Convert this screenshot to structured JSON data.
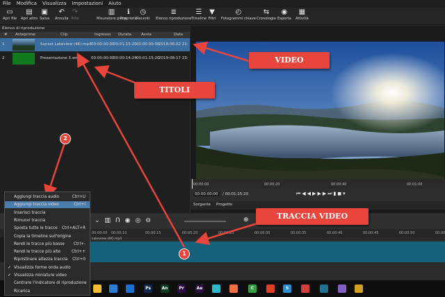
{
  "menubar": [
    "File",
    "Modifica",
    "Visualizza",
    "Impostazioni",
    "Aiuto"
  ],
  "toolbar": [
    {
      "label": "Apri file",
      "icon": "folder-icon",
      "enabled": true
    },
    {
      "label": "Apri altro",
      "icon": "open-other-icon",
      "enabled": true
    },
    {
      "label": "Salva",
      "icon": "save-icon",
      "enabled": true
    },
    {
      "label": "Annulla",
      "icon": "undo-icon",
      "enabled": true
    },
    {
      "label": "Rifai",
      "icon": "redo-icon",
      "enabled": false
    },
    {
      "label": "Misuratore picco",
      "icon": "peak-meter-icon",
      "enabled": true
    },
    {
      "label": "Proprietà",
      "icon": "info-icon",
      "enabled": true
    },
    {
      "label": "Recenti",
      "icon": "clock-icon",
      "enabled": true
    },
    {
      "label": "Elenco riproduzione",
      "icon": "playlist-icon",
      "enabled": true
    },
    {
      "label": "Timeline",
      "icon": "timeline-icon",
      "enabled": true
    },
    {
      "label": "Filtri",
      "icon": "filter-icon",
      "enabled": true
    },
    {
      "label": "Fotogrammi chiave",
      "icon": "stopwatch-icon",
      "enabled": true
    },
    {
      "label": "Cronologia",
      "icon": "history-icon",
      "enabled": true
    },
    {
      "label": "Esporta",
      "icon": "export-icon",
      "enabled": true
    },
    {
      "label": "Attività",
      "icon": "jobs-icon",
      "enabled": true
    }
  ],
  "playlist": {
    "title": "Elenco di riproduzione",
    "columns": [
      "#",
      "Anteprime",
      "Clip",
      "Ingresso",
      "Durata",
      "Avvia",
      "Data"
    ],
    "rows": [
      {
        "num": "1",
        "clip": "Sunset Lakeview (4K).mp4",
        "in": "00:00:00:00",
        "dur": "00:01:15:20",
        "start": "00:00:00:00",
        "date": "2018-06-02 21:"
      },
      {
        "num": "2",
        "clip": "Presentazione 3.wmv",
        "in": "00:00:00:00",
        "dur": "00:00:14:24",
        "start": "00:01:15:20",
        "date": "2019-08-17 23:"
      }
    ]
  },
  "player": {
    "ruler": [
      "00:00:00",
      "00:00:20",
      "00:00:40",
      "00:01:00"
    ],
    "position": "00:00:00:00",
    "duration": "/ 00:01:15:20",
    "tabs": [
      "Sorgente",
      "Progetto"
    ]
  },
  "timeline": {
    "ruler": [
      "00:00:00",
      "00:00:10",
      "00:00:15",
      "00:00:20",
      "00:00:25",
      "00:00:30",
      "00:00:35",
      "00:00:40",
      "00:00:45",
      "00:00:50",
      "00:00:5"
    ],
    "clip_label": "Lakeview (4K).mp4"
  },
  "context_menu": [
    {
      "label": "Aggiungi traccia audio",
      "shortcut": "Ctrl+U",
      "checked": false,
      "highlighted": false
    },
    {
      "label": "Aggiungi traccia video",
      "shortcut": "Ctrl+I",
      "checked": false,
      "highlighted": true
    },
    {
      "label": "Inserisci traccia",
      "shortcut": "",
      "checked": false,
      "highlighted": false
    },
    {
      "label": "Rimuovi traccia",
      "shortcut": "",
      "checked": false,
      "highlighted": false
    },
    {
      "label": "Sposta tutte le tracce",
      "shortcut": "Ctrl+ALT+R",
      "checked": false,
      "highlighted": false
    },
    {
      "label": "Copia la timeline sull'origine",
      "shortcut": "",
      "checked": false,
      "highlighted": false
    },
    {
      "label": "Rendi le tracce più basse",
      "shortcut": "Ctrl+-",
      "checked": false,
      "highlighted": false
    },
    {
      "label": "Rendi le tracce più alte",
      "shortcut": "Ctrl++",
      "checked": false,
      "highlighted": false
    },
    {
      "label": "Ripristinare altezza traccia",
      "shortcut": "Ctrl+0",
      "checked": false,
      "highlighted": false
    },
    {
      "label": "Visualizza forme onda audio",
      "shortcut": "",
      "checked": true,
      "highlighted": false
    },
    {
      "label": "Visualizza miniature video",
      "shortcut": "",
      "checked": true,
      "highlighted": false
    },
    {
      "label": "Centrare l'indicatore di riproduzione",
      "shortcut": "",
      "checked": false,
      "highlighted": false
    },
    {
      "label": "Ricarica",
      "shortcut": "",
      "checked": false,
      "highlighted": false
    }
  ],
  "callouts": {
    "video": "VIDEO",
    "titoli": "TITOLI",
    "traccia": "TRACCIA VIDEO",
    "badge1": "1",
    "badge2": "2"
  },
  "taskbar_apps": [
    {
      "name": "explorer-icon",
      "color": "#f0c030",
      "glyph": ""
    },
    {
      "name": "store-icon",
      "color": "#2a7fd4",
      "glyph": ""
    },
    {
      "name": "windows-app-icon",
      "color": "#1a6fd0",
      "glyph": ""
    },
    {
      "name": "photoshop-icon",
      "color": "#0b2a4a",
      "glyph": "Ps"
    },
    {
      "name": "animate-icon",
      "color": "#0a3a20",
      "glyph": "An"
    },
    {
      "name": "premiere-icon",
      "color": "#2a0a40",
      "glyph": "Pr"
    },
    {
      "name": "after-effects-icon",
      "color": "#2a0a40",
      "glyph": "Ae"
    },
    {
      "name": "sticky-icon",
      "color": "#2fb8c8",
      "glyph": ""
    },
    {
      "name": "app-icon",
      "color": "#f07040",
      "glyph": ""
    },
    {
      "name": "camtasia-icon",
      "color": "#30a040",
      "glyph": "C"
    },
    {
      "name": "app2-icon",
      "color": "#e0402a",
      "glyph": ""
    },
    {
      "name": "skype-like-icon",
      "color": "#2a90d0",
      "glyph": "S"
    },
    {
      "name": "app3-icon",
      "color": "#d04040",
      "glyph": ""
    },
    {
      "name": "shotcut-icon",
      "color": "#1f6f8f",
      "glyph": ""
    },
    {
      "name": "app4-icon",
      "color": "#8060c0",
      "glyph": ""
    },
    {
      "name": "chrome-icon",
      "color": "#d0a020",
      "glyph": ""
    }
  ]
}
